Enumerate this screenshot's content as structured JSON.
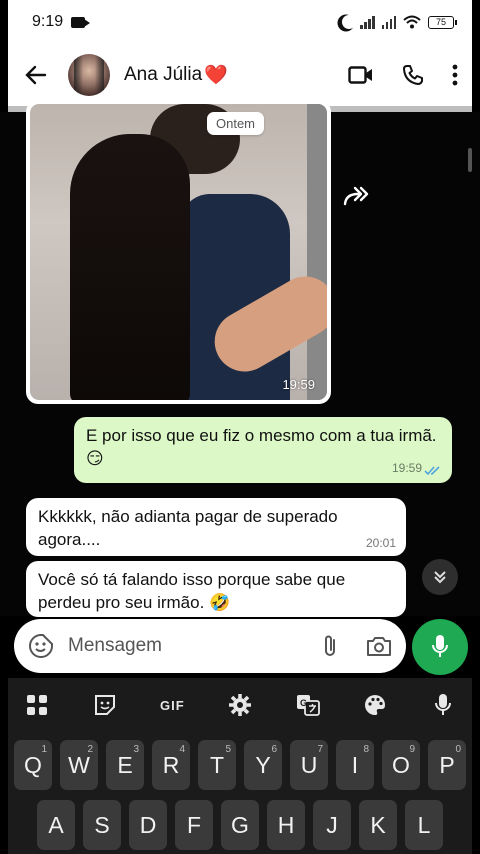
{
  "status_bar": {
    "time": "9:19",
    "battery": "75"
  },
  "header": {
    "contact_name": "Ana Júlia",
    "heart": "❤️",
    "icons": [
      "back-arrow-icon",
      "video-call-icon",
      "phone-icon",
      "more-vert-icon"
    ]
  },
  "chat": {
    "date_chip": "Ontem",
    "image_message": {
      "time": "19:59"
    },
    "outgoing": [
      {
        "text": "E por isso que eu fiz o mesmo com a tua irmã. ",
        "emoji": "😏",
        "time": "19:59",
        "read": true
      }
    ],
    "incoming": [
      {
        "text": "Kkkkkk, não adianta pagar de superado agora....",
        "time": "20:01"
      },
      {
        "text": "Você só tá falando isso porque sabe que perdeu pro seu irmão. ",
        "emoji": "🤣"
      }
    ]
  },
  "compose": {
    "placeholder": "Mensagem"
  },
  "keyboard": {
    "toolbar": [
      "apps-icon",
      "sticker-icon",
      "GIF",
      "settings-icon",
      "translate-icon",
      "palette-icon",
      "mic-icon"
    ],
    "gif_label": "GIF",
    "row1": [
      {
        "k": "Q",
        "n": "1"
      },
      {
        "k": "W",
        "n": "2"
      },
      {
        "k": "E",
        "n": "3"
      },
      {
        "k": "R",
        "n": "4"
      },
      {
        "k": "T",
        "n": "5"
      },
      {
        "k": "Y",
        "n": "6"
      },
      {
        "k": "U",
        "n": "7"
      },
      {
        "k": "I",
        "n": "8"
      },
      {
        "k": "O",
        "n": "9"
      },
      {
        "k": "P",
        "n": "0"
      }
    ],
    "row2": [
      "A",
      "S",
      "D",
      "F",
      "G",
      "H",
      "J",
      "K",
      "L"
    ]
  },
  "colors": {
    "outgoing_bubble": "#dcf8c6",
    "send_button": "#1ea952",
    "read_ticks": "#4fa3e0"
  }
}
